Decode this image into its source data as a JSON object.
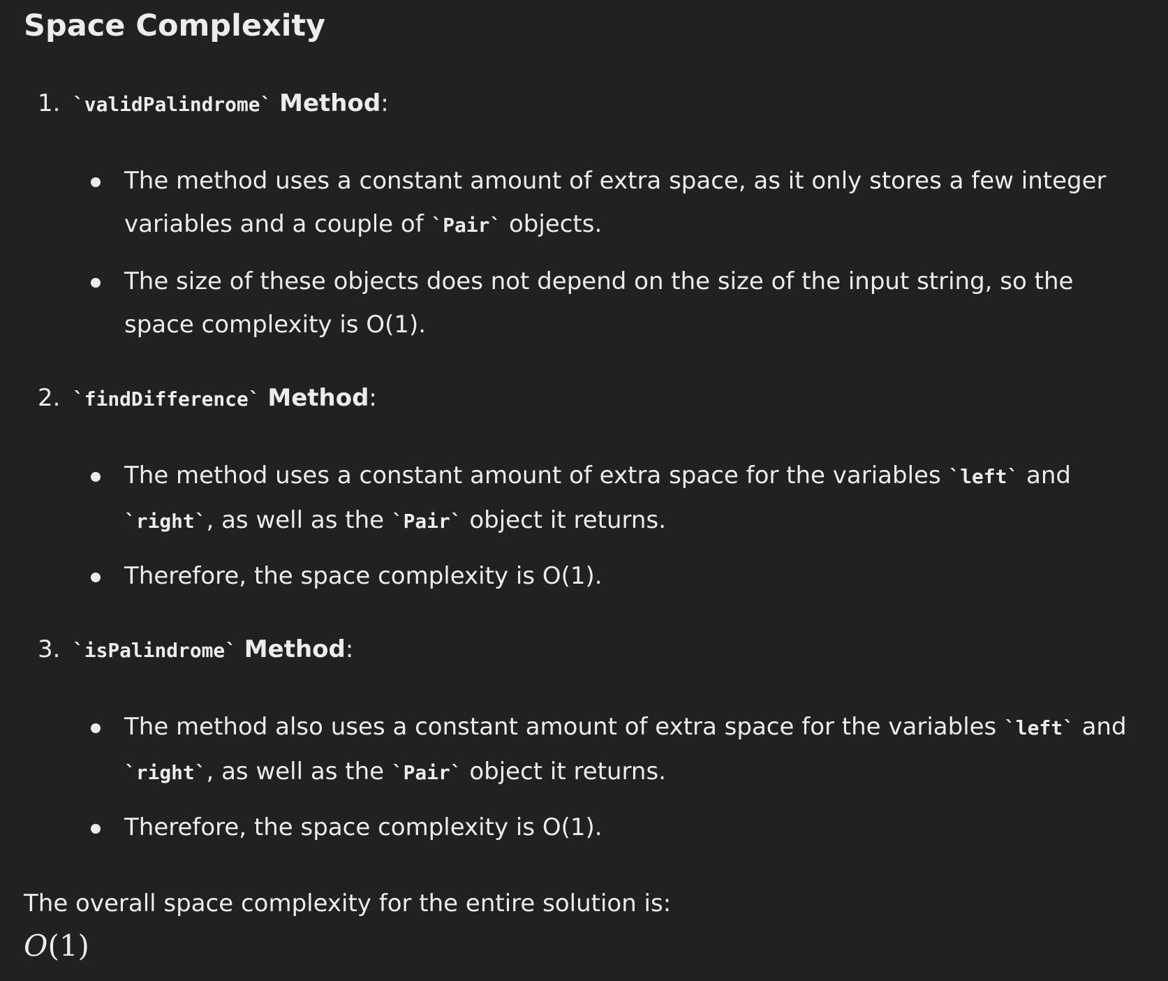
{
  "heading": "Space Complexity",
  "steps": [
    {
      "number": "1.",
      "method_name": "validPalindrome",
      "method_suffix": "Method",
      "bullets": [
        {
          "parts": [
            {
              "t": "The method uses a constant amount of extra space, as it only stores a few integer variables and a couple of "
            },
            {
              "code": "Pair"
            },
            {
              "t": " objects."
            }
          ]
        },
        {
          "parts": [
            {
              "t": "The size of these objects does not depend on the size of the input string, so the space complexity is O(1)."
            }
          ]
        }
      ]
    },
    {
      "number": "2.",
      "method_name": "findDifference",
      "method_suffix": "Method",
      "bullets": [
        {
          "parts": [
            {
              "t": "The method uses a constant amount of extra space for the variables "
            },
            {
              "code": "left"
            },
            {
              "t": " and "
            },
            {
              "code": "right"
            },
            {
              "t": ", as well as the "
            },
            {
              "code": "Pair"
            },
            {
              "t": " object it returns."
            }
          ]
        },
        {
          "parts": [
            {
              "t": "Therefore, the space complexity is O(1)."
            }
          ]
        }
      ]
    },
    {
      "number": "3.",
      "method_name": "isPalindrome",
      "method_suffix": "Method",
      "bullets": [
        {
          "parts": [
            {
              "t": "The method also uses a constant amount of extra space for the variables "
            },
            {
              "code": "left"
            },
            {
              "t": " and "
            },
            {
              "code": "right"
            },
            {
              "t": ", as well as the "
            },
            {
              "code": "Pair"
            },
            {
              "t": " object it returns."
            }
          ]
        },
        {
          "parts": [
            {
              "t": "Therefore, the space complexity is O(1)."
            }
          ]
        }
      ]
    }
  ],
  "summary": "The overall space complexity for the entire solution is:",
  "result_var": "O",
  "result_arg": "(1)"
}
